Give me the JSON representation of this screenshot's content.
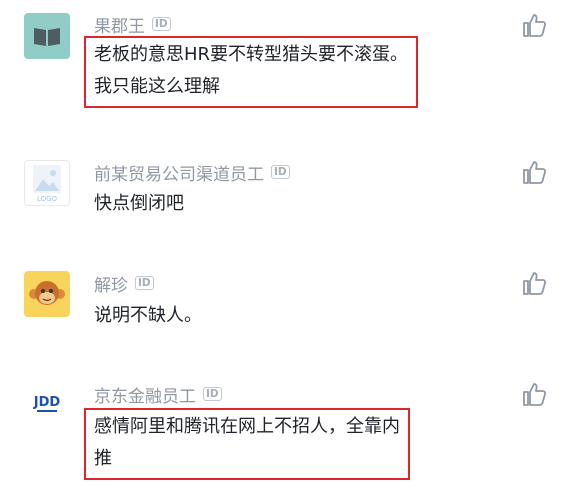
{
  "comments": [
    {
      "author": "果郡王",
      "badge": "ID",
      "lines": [
        "老板的意思HR要不转型猎头要不滚蛋。",
        "我只能这么理解"
      ],
      "avatar": "book-icon",
      "avatar_bg": "#8fcdc6",
      "highlighted": true
    },
    {
      "author": "前某贸易公司渠道员工",
      "badge": "ID",
      "lines": [
        "快点倒闭吧"
      ],
      "avatar": "logo-placeholder",
      "avatar_text": "LOGO",
      "highlighted": false
    },
    {
      "author": "解珍",
      "badge": "ID",
      "lines": [
        "说明不缺人。"
      ],
      "avatar": "monkey-icon",
      "avatar_bg": "#f9d45c",
      "highlighted": false
    },
    {
      "author": "京东金融员工",
      "badge": "ID",
      "lines": [
        "感情阿里和腾讯在网上不招人，全靠内",
        "推"
      ],
      "avatar": "jdd-logo",
      "avatar_text": "JDD",
      "highlighted": true
    }
  ],
  "colors": {
    "highlight_border": "#e0262d",
    "meta_text": "#8f98a3",
    "body_text": "#1f2329"
  }
}
